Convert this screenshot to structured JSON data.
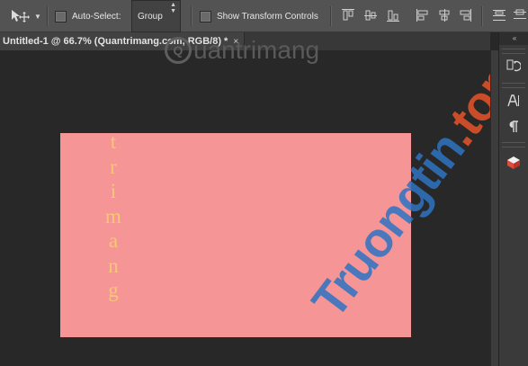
{
  "options_bar": {
    "move_tool_icon": "move-tool-icon",
    "auto_select_label": "Auto-Select:",
    "group_value": "Group",
    "show_transform_label": "Show Transform Controls"
  },
  "document": {
    "tab_title": "Untitled-1 @ 66.7% (Quantrimang.com, RGB/8) *",
    "close_glyph": "×"
  },
  "canvas": {
    "background_color": "#f59595",
    "text_color": "#f5c877",
    "vertical_text_letters": [
      "t",
      "r",
      "i",
      "m",
      "a",
      "n",
      "g"
    ]
  },
  "watermarks": {
    "top_logo_text": "uantrimang",
    "top_logo_glyph": "Q",
    "diagonal_part1": "Truongtin",
    "diagonal_part2": ".top"
  },
  "right_panel": {
    "collapse_glyph": "«"
  }
}
